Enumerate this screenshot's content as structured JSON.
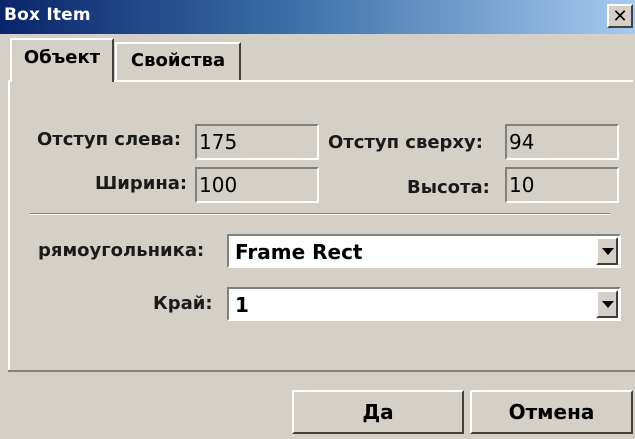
{
  "window": {
    "title": "Box Item",
    "close_glyph": "✕"
  },
  "tabs": [
    {
      "label": "Объект",
      "active": true
    },
    {
      "label": "Свойства",
      "active": false
    }
  ],
  "fields": {
    "left": {
      "label": "Отступ слева:",
      "value": "175"
    },
    "top": {
      "label": "Отступ сверху:",
      "value": "94"
    },
    "width": {
      "label": "Ширина:",
      "value": "100"
    },
    "height": {
      "label": "Высота:",
      "value": "10"
    }
  },
  "selects": {
    "rect_type": {
      "label": "рямоугольника:",
      "value": "Frame Rect"
    },
    "border": {
      "label": "Край:",
      "value": "1"
    }
  },
  "buttons": {
    "ok": "Да",
    "cancel": "Отмена"
  }
}
